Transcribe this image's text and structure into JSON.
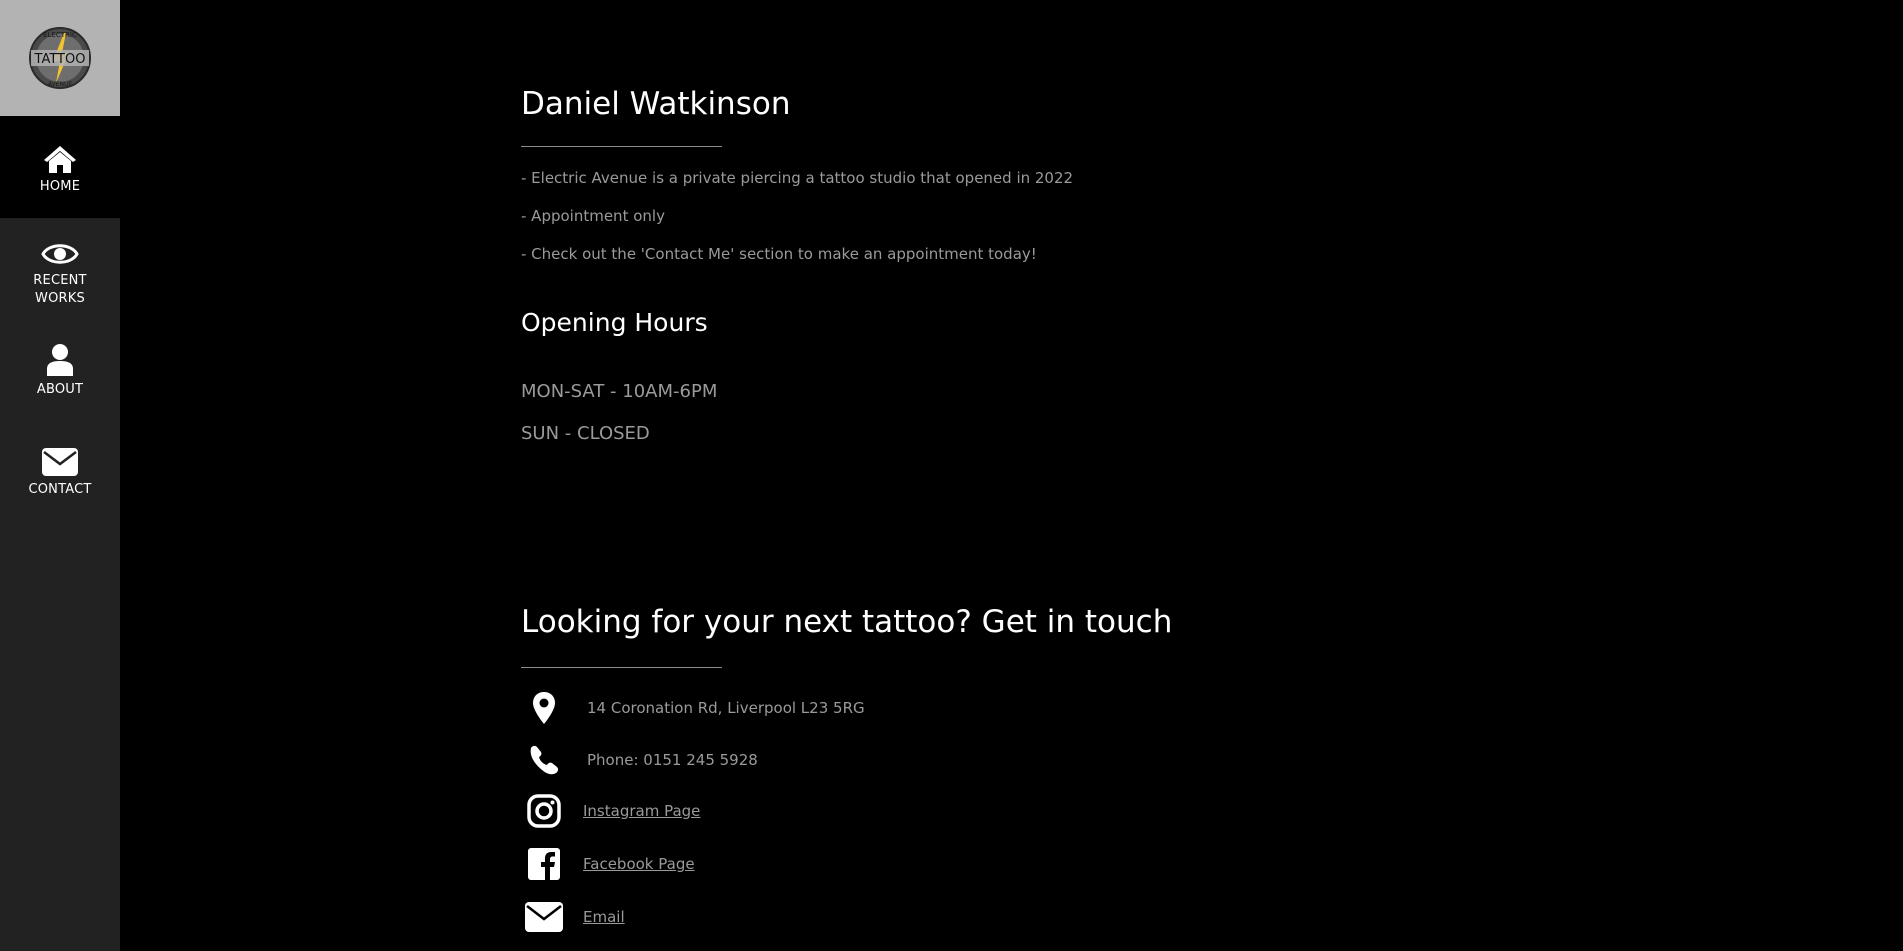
{
  "brand": {
    "logo_top": "ELECTRIC",
    "logo_middle": "TATTOO",
    "logo_bottom": "AVENUE",
    "logo_bg": "#b3b3b3",
    "accent": "#f2c230"
  },
  "sidebar": {
    "items": [
      {
        "label": "HOME",
        "icon": "home-icon",
        "active": true
      },
      {
        "label_line1": "RECENT",
        "label_line2": "WORKS",
        "icon": "eye-icon"
      },
      {
        "label": "ABOUT",
        "icon": "user-icon"
      },
      {
        "label": "CONTACT",
        "icon": "envelope-icon"
      }
    ],
    "background": "#222222",
    "active_background": "#000000"
  },
  "main": {
    "title": "Daniel Watkinson",
    "intro": [
      "- Electric Avenue is a private piercing a tattoo studio that opened in 2022",
      "- Appointment only",
      "- Check out the 'Contact Me' section to make an appointment today!"
    ],
    "hours_title": "Opening Hours",
    "hours": [
      "MON-SAT - 10AM-6PM",
      "SUN - CLOSED"
    ]
  },
  "contact": {
    "title": "Looking for your next tattoo? Get in touch",
    "address": "14 Coronation Rd, Liverpool L23 5RG",
    "phone": "Phone: 0151 245 5928",
    "instagram": "Instagram Page",
    "facebook": "Facebook Page",
    "email": "Email"
  }
}
